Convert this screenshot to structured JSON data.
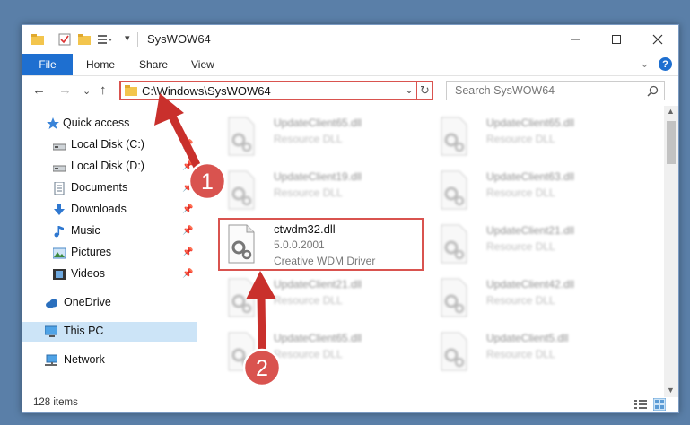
{
  "window": {
    "title": "SysWOW64"
  },
  "ribbon": {
    "tabs": [
      "File",
      "Home",
      "Share",
      "View"
    ]
  },
  "address": {
    "path": "C:\\Windows\\SysWOW64"
  },
  "search": {
    "placeholder": "Search SysWOW64"
  },
  "sidebar": {
    "items": [
      {
        "label": "Quick access",
        "icon": "star-icon",
        "pinned": false
      },
      {
        "label": "Local Disk (C:)",
        "icon": "drive-icon",
        "pinned": true
      },
      {
        "label": "Local Disk (D:)",
        "icon": "drive-icon",
        "pinned": true
      },
      {
        "label": "Documents",
        "icon": "documents-icon",
        "pinned": true
      },
      {
        "label": "Downloads",
        "icon": "download-icon",
        "pinned": true
      },
      {
        "label": "Music",
        "icon": "music-icon",
        "pinned": true
      },
      {
        "label": "Pictures",
        "icon": "pictures-icon",
        "pinned": true
      },
      {
        "label": "Videos",
        "icon": "videos-icon",
        "pinned": true
      },
      {
        "label": "OneDrive",
        "icon": "cloud-icon",
        "pinned": false
      },
      {
        "label": "This PC",
        "icon": "computer-icon",
        "pinned": false,
        "selected": true
      },
      {
        "label": "Network",
        "icon": "network-icon",
        "pinned": false
      }
    ]
  },
  "files": {
    "left": [
      {
        "name": "UpdateClient65.dll",
        "desc": "Resource DLL"
      },
      {
        "name": "UpdateClient19.dll",
        "desc": "Resource DLL"
      },
      {
        "name": "ctwdm32.dll",
        "version": "5.0.0.2001",
        "desc": "Creative WDM Driver"
      },
      {
        "name": "UpdateClient21.dll",
        "desc": "Resource DLL"
      },
      {
        "name": "UpdateClient65.dll",
        "desc": "Resource DLL"
      }
    ],
    "right": [
      {
        "name": "UpdateClient65.dll",
        "desc": "Resource DLL"
      },
      {
        "name": "UpdateClient63.dll",
        "desc": "Resource DLL"
      },
      {
        "name": "UpdateClient21.dll",
        "desc": "Resource DLL"
      },
      {
        "name": "UpdateClient42.dll",
        "desc": "Resource DLL"
      },
      {
        "name": "UpdateClient5.dll",
        "desc": "Resource DLL"
      }
    ]
  },
  "status": {
    "count": "128 items"
  },
  "annotations": {
    "step1": "1",
    "step2": "2"
  },
  "colors": {
    "accent": "#1e6fd0",
    "annotation": "#d9534f",
    "selection": "#cce4f7"
  }
}
